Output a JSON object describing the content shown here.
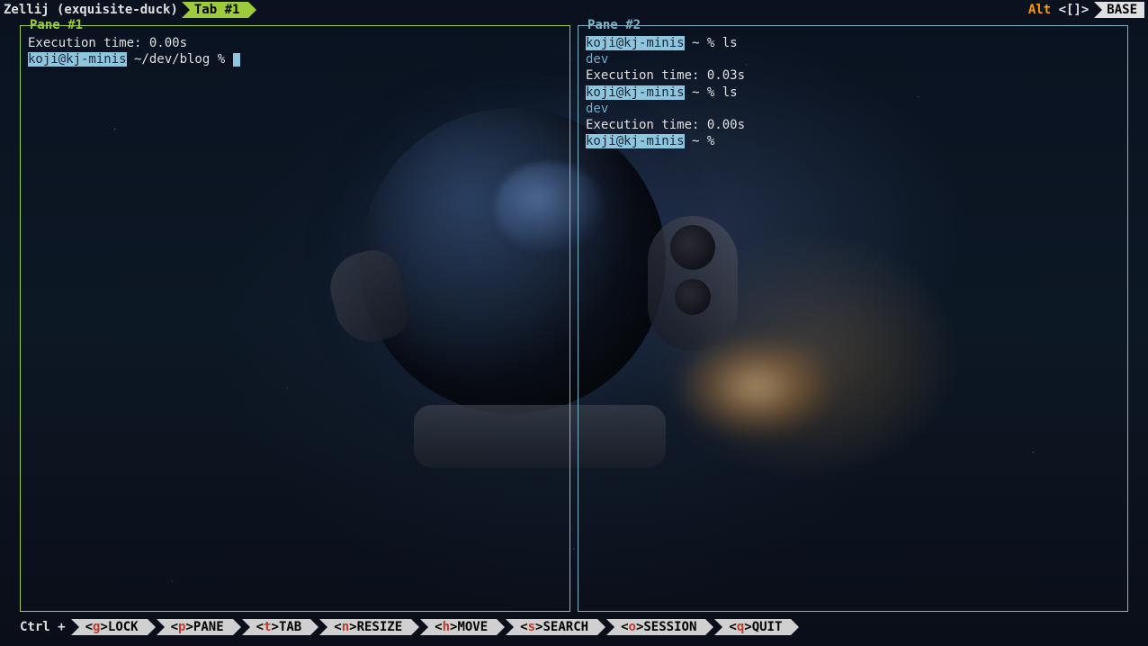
{
  "header": {
    "session_label": "Zellij (exquisite-duck)",
    "tab_label": "Tab #1",
    "alt_label": "Alt",
    "alt_brackets": "<[]>",
    "mode_label": "BASE"
  },
  "panes": {
    "p1": {
      "title": "Pane #1",
      "line1": "Execution time: 0.00s",
      "userhost": "koji@kj-minis",
      "path": " ~/dev/blog % "
    },
    "p2": {
      "title": "Pane #2",
      "lines": {
        "uh1": "koji@kj-minis",
        "pp1": " ~ % ls",
        "out1": "dev",
        "exec1": "Execution time: 0.03s",
        "uh2": "koji@kj-minis",
        "pp2": " ~ % ls",
        "out2": "dev",
        "exec2": "Execution time: 0.00s",
        "uh3": "koji@kj-minis",
        "pp3": " ~ % "
      }
    }
  },
  "footer": {
    "ctrl": "Ctrl +",
    "items": [
      {
        "key": "g",
        "label": "LOCK"
      },
      {
        "key": "p",
        "label": "PANE"
      },
      {
        "key": "t",
        "label": "TAB"
      },
      {
        "key": "n",
        "label": "RESIZE"
      },
      {
        "key": "h",
        "label": "MOVE"
      },
      {
        "key": "s",
        "label": "SEARCH"
      },
      {
        "key": "o",
        "label": "SESSION"
      },
      {
        "key": "q",
        "label": "QUIT"
      }
    ]
  }
}
